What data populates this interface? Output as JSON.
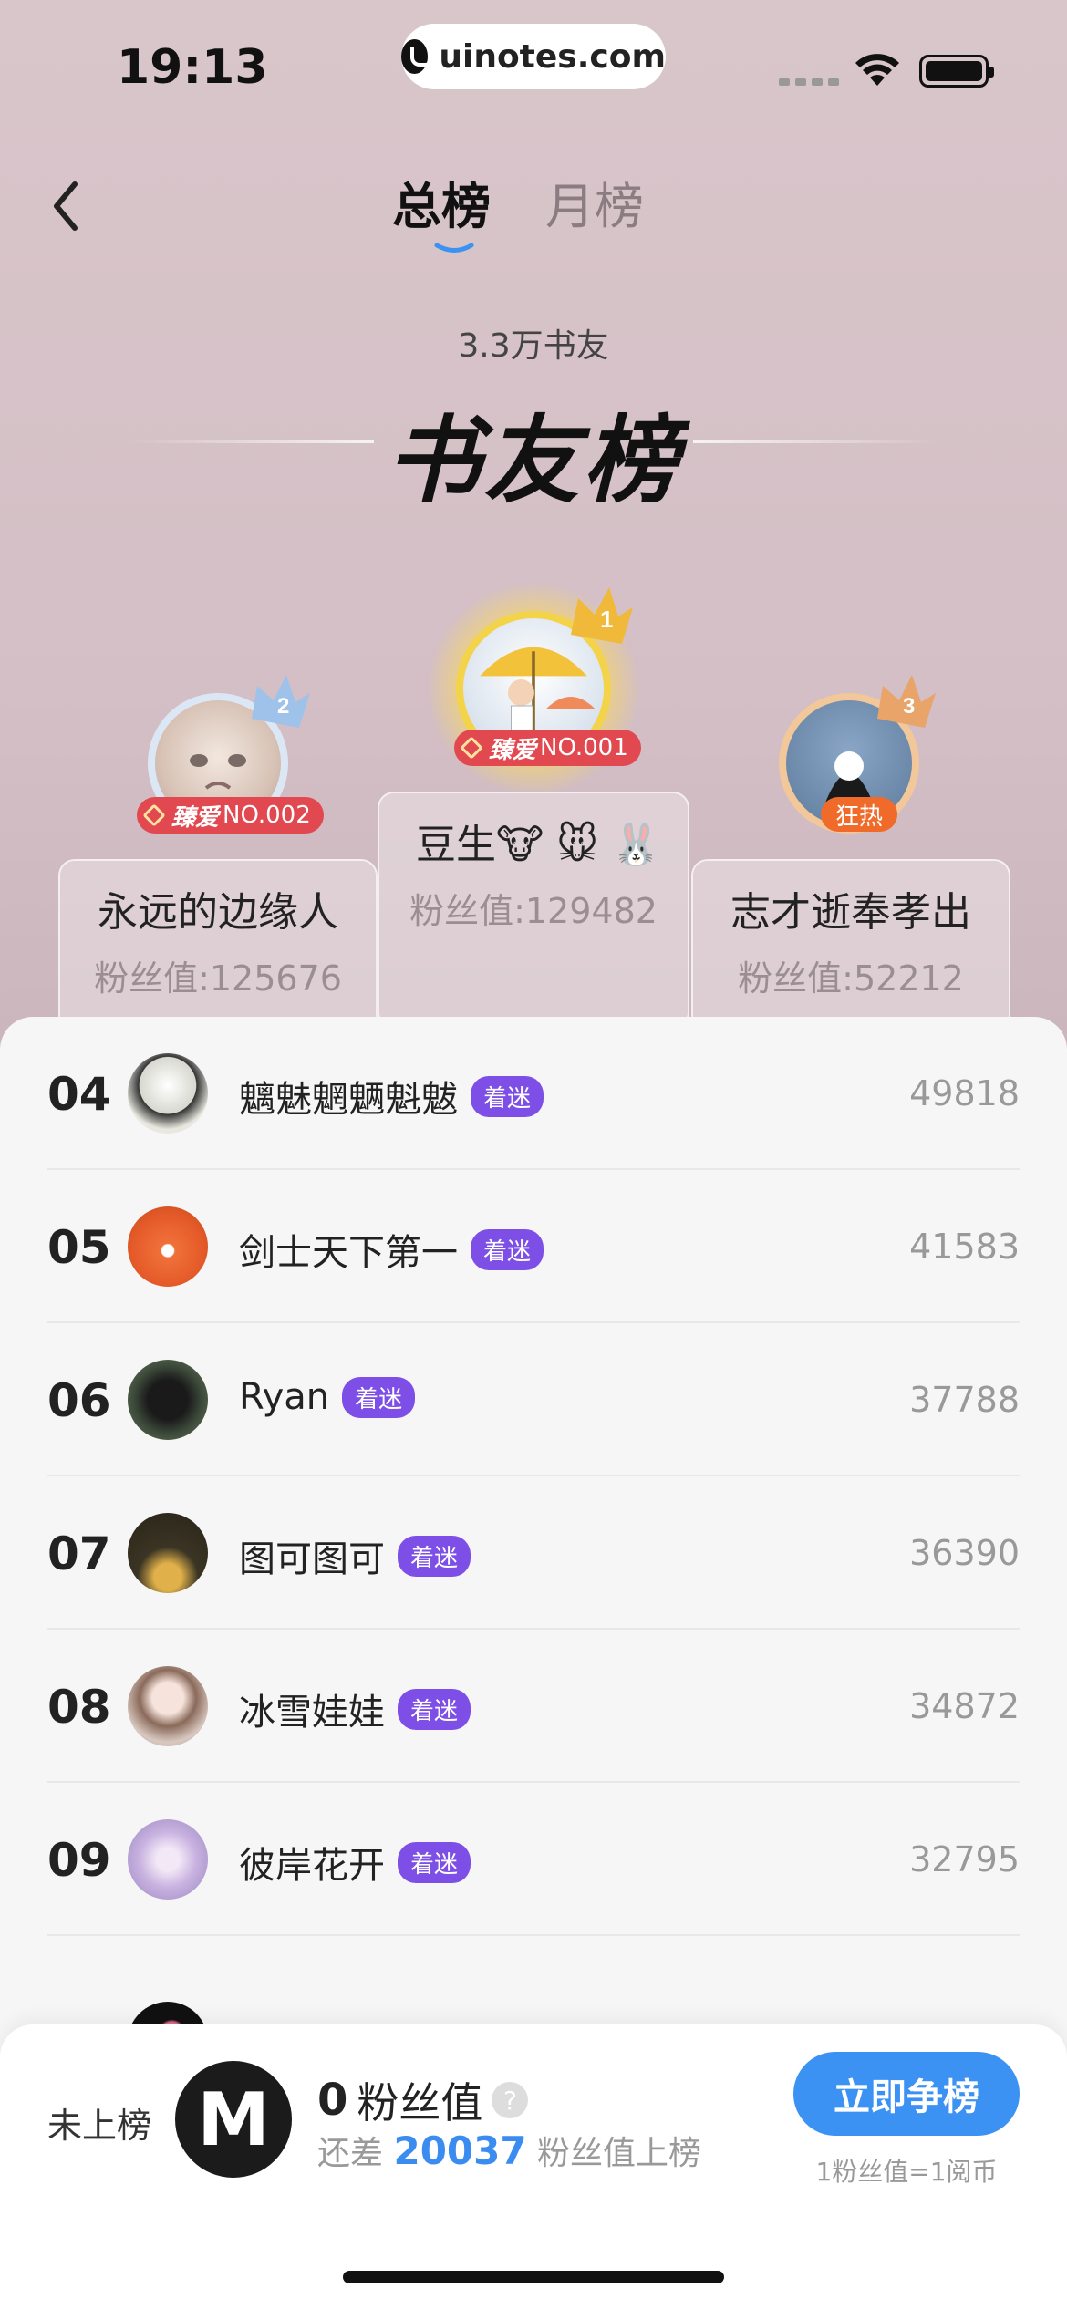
{
  "status": {
    "time": "19:13",
    "url": "uinotes.com"
  },
  "tabs": [
    {
      "label": "总榜",
      "active": true
    },
    {
      "label": "月榜",
      "active": false
    }
  ],
  "header": {
    "fans_count": "3.3万书友",
    "board_title": "书友榜"
  },
  "podium": {
    "first": {
      "name": "豆生🐮 🐭 🐰",
      "value": "粉丝值:129482",
      "badge_prefix": "臻爱",
      "badge_no": "NO.001",
      "crown": "1"
    },
    "second": {
      "name": "永远的边缘人",
      "value": "粉丝值:125676",
      "badge_prefix": "臻爱",
      "badge_no": "NO.002",
      "crown": "2"
    },
    "third": {
      "name": "志才逝奉孝出",
      "value": "粉丝值:52212",
      "badge": "狂热",
      "crown": "3"
    }
  },
  "list": [
    {
      "rank": "04",
      "name": "魑魅魍魉魁魃",
      "tag": "着迷",
      "value": "49818"
    },
    {
      "rank": "05",
      "name": "剑士天下第一",
      "tag": "着迷",
      "value": "41583"
    },
    {
      "rank": "06",
      "name": "Ryan",
      "tag": "着迷",
      "value": "37788"
    },
    {
      "rank": "07",
      "name": "图可图可",
      "tag": "着迷",
      "value": "36390"
    },
    {
      "rank": "08",
      "name": "冰雪娃娃",
      "tag": "着迷",
      "value": "34872"
    },
    {
      "rank": "09",
      "name": "彼岸花开",
      "tag": "着迷",
      "value": "32795"
    }
  ],
  "me": {
    "status": "未上榜",
    "fans_value": "0",
    "fans_unit": "粉丝值",
    "gap_prefix": "还差",
    "gap_num": "20037",
    "gap_suffix": "粉丝值上榜",
    "cta": "立即争榜",
    "cta_note": "1粉丝值=1阅币",
    "avatar_letter": "M"
  },
  "colors": {
    "accent": "#3b92f2",
    "tag": "#7d4fe6",
    "badge_red": "#e2484f",
    "badge_hot": "#f06a2a"
  }
}
